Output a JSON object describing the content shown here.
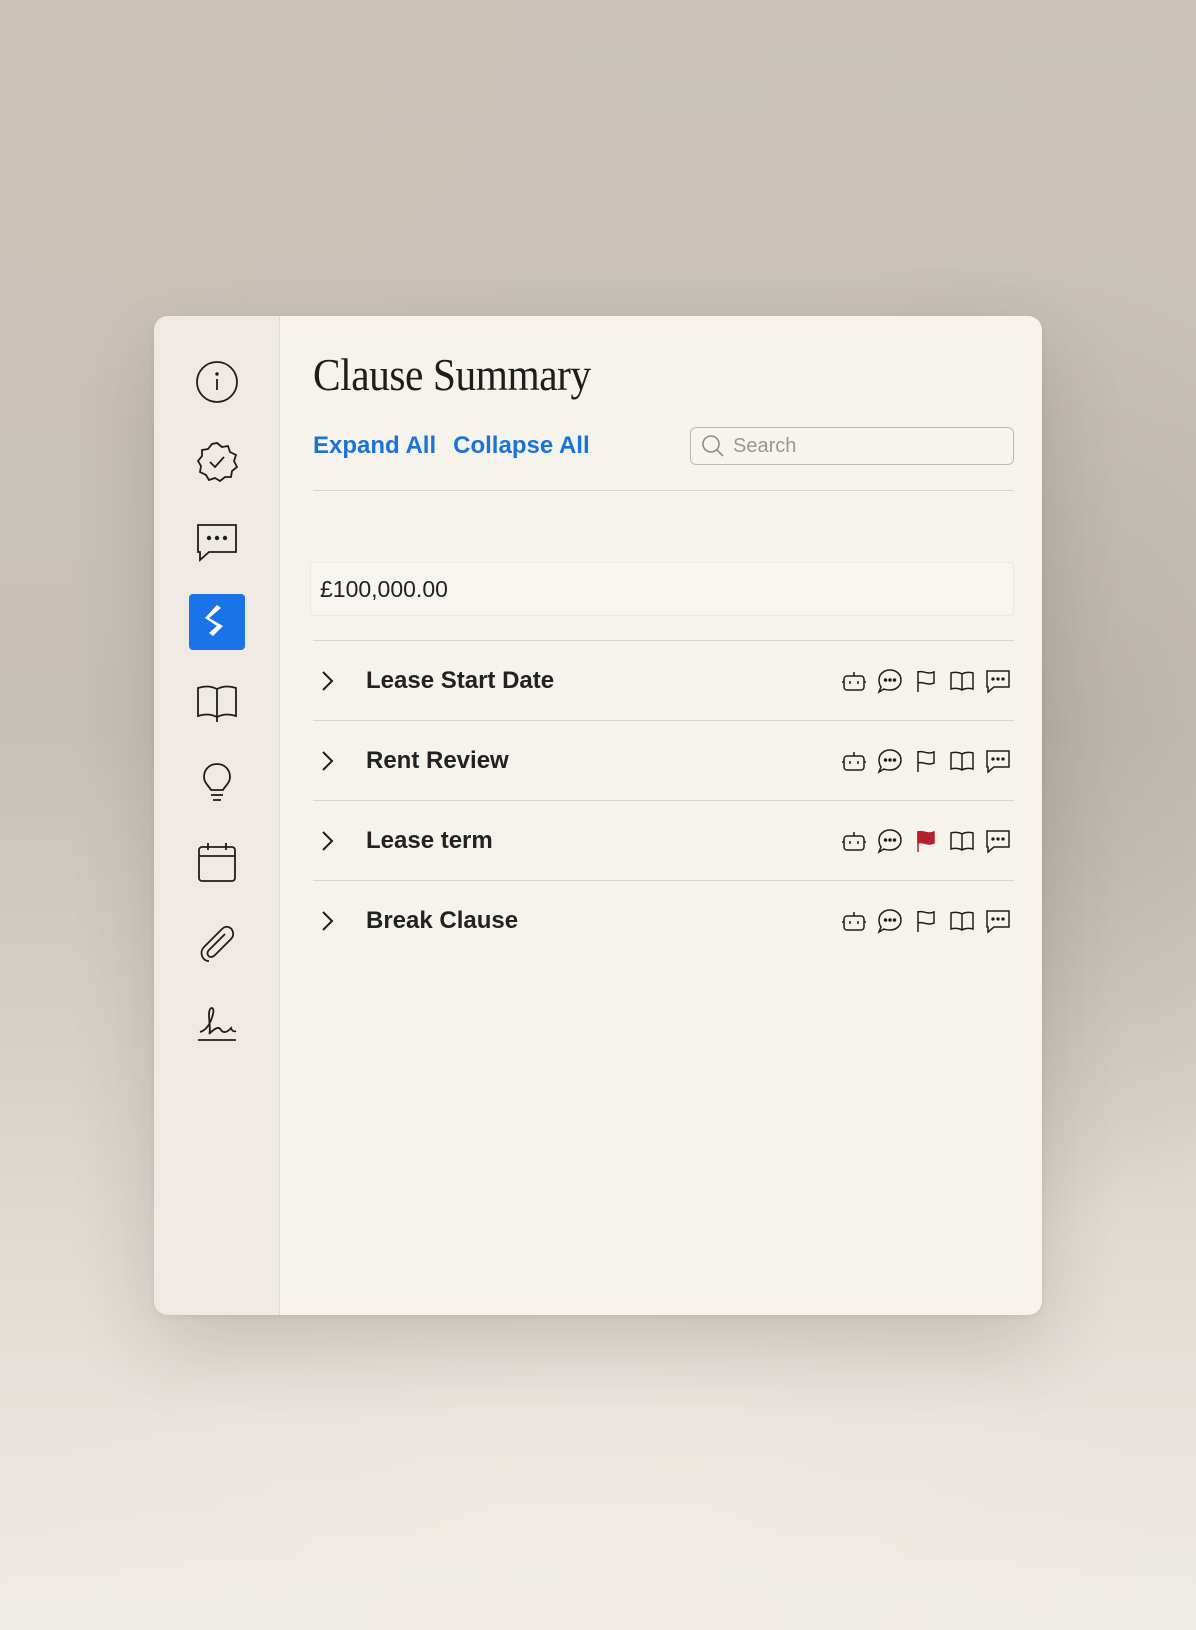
{
  "panel": {
    "title": "Clause Summary",
    "expand_all": "Expand All",
    "collapse_all": "Collapse All",
    "search_placeholder": "Search",
    "amount_value": "£100,000.00"
  },
  "sidebar": {
    "items": [
      {
        "icon": "info-icon"
      },
      {
        "icon": "verified-badge-icon"
      },
      {
        "icon": "chat-icon"
      },
      {
        "icon": "brand-s-icon",
        "active": true
      },
      {
        "icon": "book-icon"
      },
      {
        "icon": "lightbulb-icon"
      },
      {
        "icon": "calendar-icon"
      },
      {
        "icon": "paperclip-icon"
      },
      {
        "icon": "signature-icon"
      }
    ],
    "active_color": "#1a73e8"
  },
  "clauses": [
    {
      "label": "Lease Start Date",
      "flagged": false
    },
    {
      "label": "Rent Review",
      "flagged": false
    },
    {
      "label": "Lease term",
      "flagged": true
    },
    {
      "label": "Break Clause",
      "flagged": false
    }
  ],
  "row_icons": [
    "robot-icon",
    "comment-icon",
    "flag-icon",
    "book-icon",
    "message-icon"
  ],
  "colors": {
    "link": "#1a73d8",
    "flag_active": "#b5202e"
  }
}
